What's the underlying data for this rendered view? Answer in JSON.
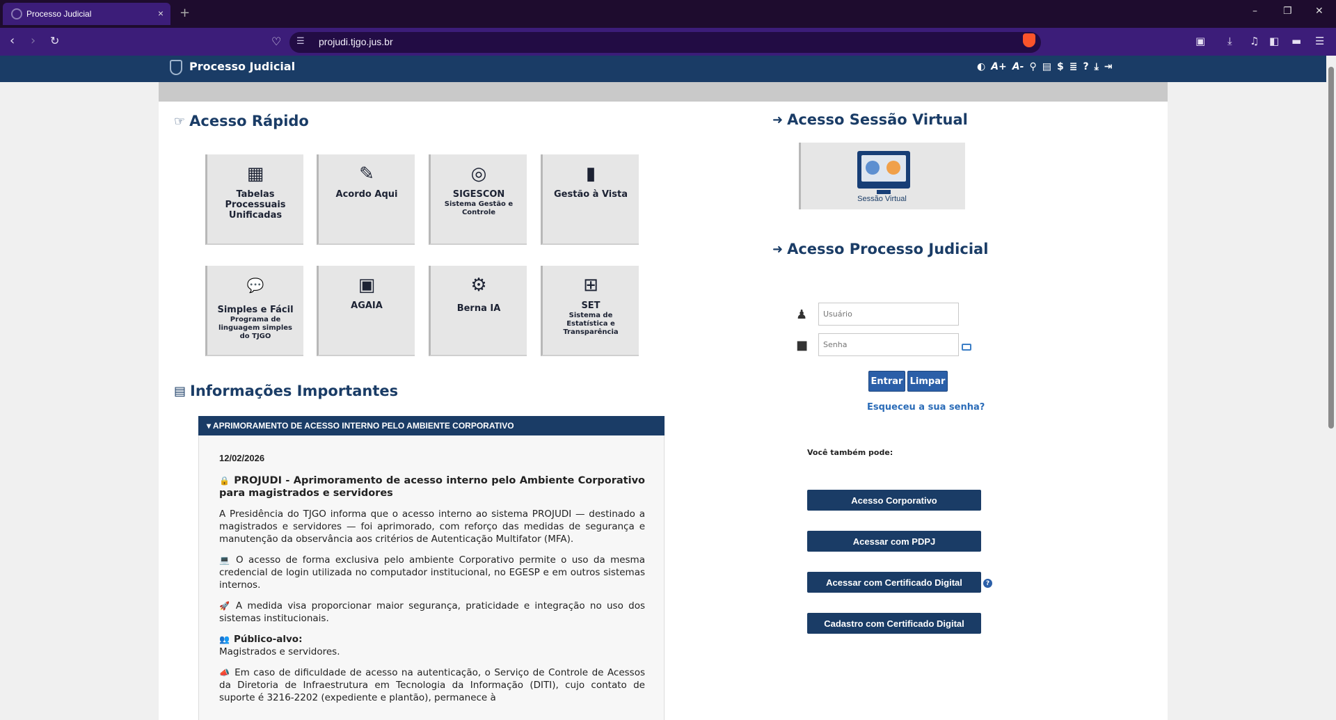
{
  "browser": {
    "tab_title": "Processo Judicial",
    "tab_close": "×",
    "new_tab": "+",
    "url": "projudi.tjgo.jus.br",
    "window": {
      "minimize": "–",
      "maximize": "❐",
      "close": "✕"
    }
  },
  "header": {
    "site_title": "Processo Judicial",
    "tools": {
      "contrast": "◐",
      "font_up": "A+",
      "font_down": "A-",
      "search": "⚲",
      "docs": "▤",
      "costs": "$",
      "stats": "≣",
      "help": "?",
      "download": "⤓",
      "exit": "⇥"
    }
  },
  "quick_access": {
    "title": "Acesso Rápido",
    "tiles": [
      {
        "title": "Tabelas Processuais Unificadas",
        "subtitle": "",
        "icon": "table-icon",
        "glyph": "▦"
      },
      {
        "title": "Acordo Aqui",
        "subtitle": "",
        "icon": "edit-icon",
        "glyph": "✎"
      },
      {
        "title": "SIGESCON",
        "subtitle": "Sistema Gestão e Controle",
        "icon": "target-icon",
        "glyph": "◎"
      },
      {
        "title": "Gestão à Vista",
        "subtitle": "",
        "icon": "bar-chart-icon",
        "glyph": "▮"
      },
      {
        "title": "Simples e Fácil",
        "subtitle": "Programa de linguagem simples do TJGO",
        "icon": "chat-icon",
        "glyph": "💬"
      },
      {
        "title": "AGAIA",
        "subtitle": "",
        "icon": "chip-icon",
        "glyph": "▣"
      },
      {
        "title": "Berna IA",
        "subtitle": "",
        "icon": "ai-gear-icon",
        "glyph": "⚙"
      },
      {
        "title": "SET",
        "subtitle": "Sistema de Estatística e Transparência",
        "icon": "network-icon",
        "glyph": "⊞"
      }
    ]
  },
  "info": {
    "title": "Informações Importantes",
    "accordion_title": "▾ APRIMORAMENTO DE ACESSO INTERNO PELO AMBIENTE CORPORATIVO",
    "date": "12/02/2026",
    "headline": "PROJUDI - Aprimoramento de acesso interno pelo Ambiente Corporativo para magistrados e servidores",
    "p1": "A Presidência do TJGO informa que o acesso interno ao sistema PROJUDI — destinado a magistrados e servidores — foi aprimorado, com reforço das medidas de segurança e manutenção da observância aos critérios de Autenticação Multifator (MFA).",
    "p2": "O acesso de forma exclusiva pelo ambiente Corporativo permite o uso da mesma credencial de login utilizada no computador institucional, no EGESP e em outros sistemas internos.",
    "p3": "A medida visa proporcionar maior segurança, praticidade e integração no uso dos sistemas institucionais.",
    "p4_title": "Público-alvo:",
    "p4_text": "Magistrados e servidores.",
    "p5": "Em caso de dificuldade de acesso na autenticação, o Serviço de Controle de Acessos da Diretoria de Infraestrutura em Tecnologia da Informação (DITI), cujo contato de suporte é 3216-2202 (expediente e plantão), permanece à"
  },
  "virtual": {
    "title": "Acesso Sessão Virtual",
    "tile_label": "Sessão Virtual"
  },
  "login": {
    "title": "Acesso Processo Judicial",
    "user_placeholder": "Usuário",
    "pass_placeholder": "Senha",
    "enter": "Entrar",
    "clear": "Limpar",
    "forgot": "Esqueceu a sua senha?",
    "also": "Você também pode:",
    "options": [
      "Acesso Corporativo",
      "Acessar com PDPJ",
      "Acessar com Certificado Digital",
      "Cadastro com Certificado Digital"
    ]
  },
  "colors": {
    "primary": "#1a3c66",
    "browser": "#3c1d79",
    "button": "#2b5fa8"
  }
}
